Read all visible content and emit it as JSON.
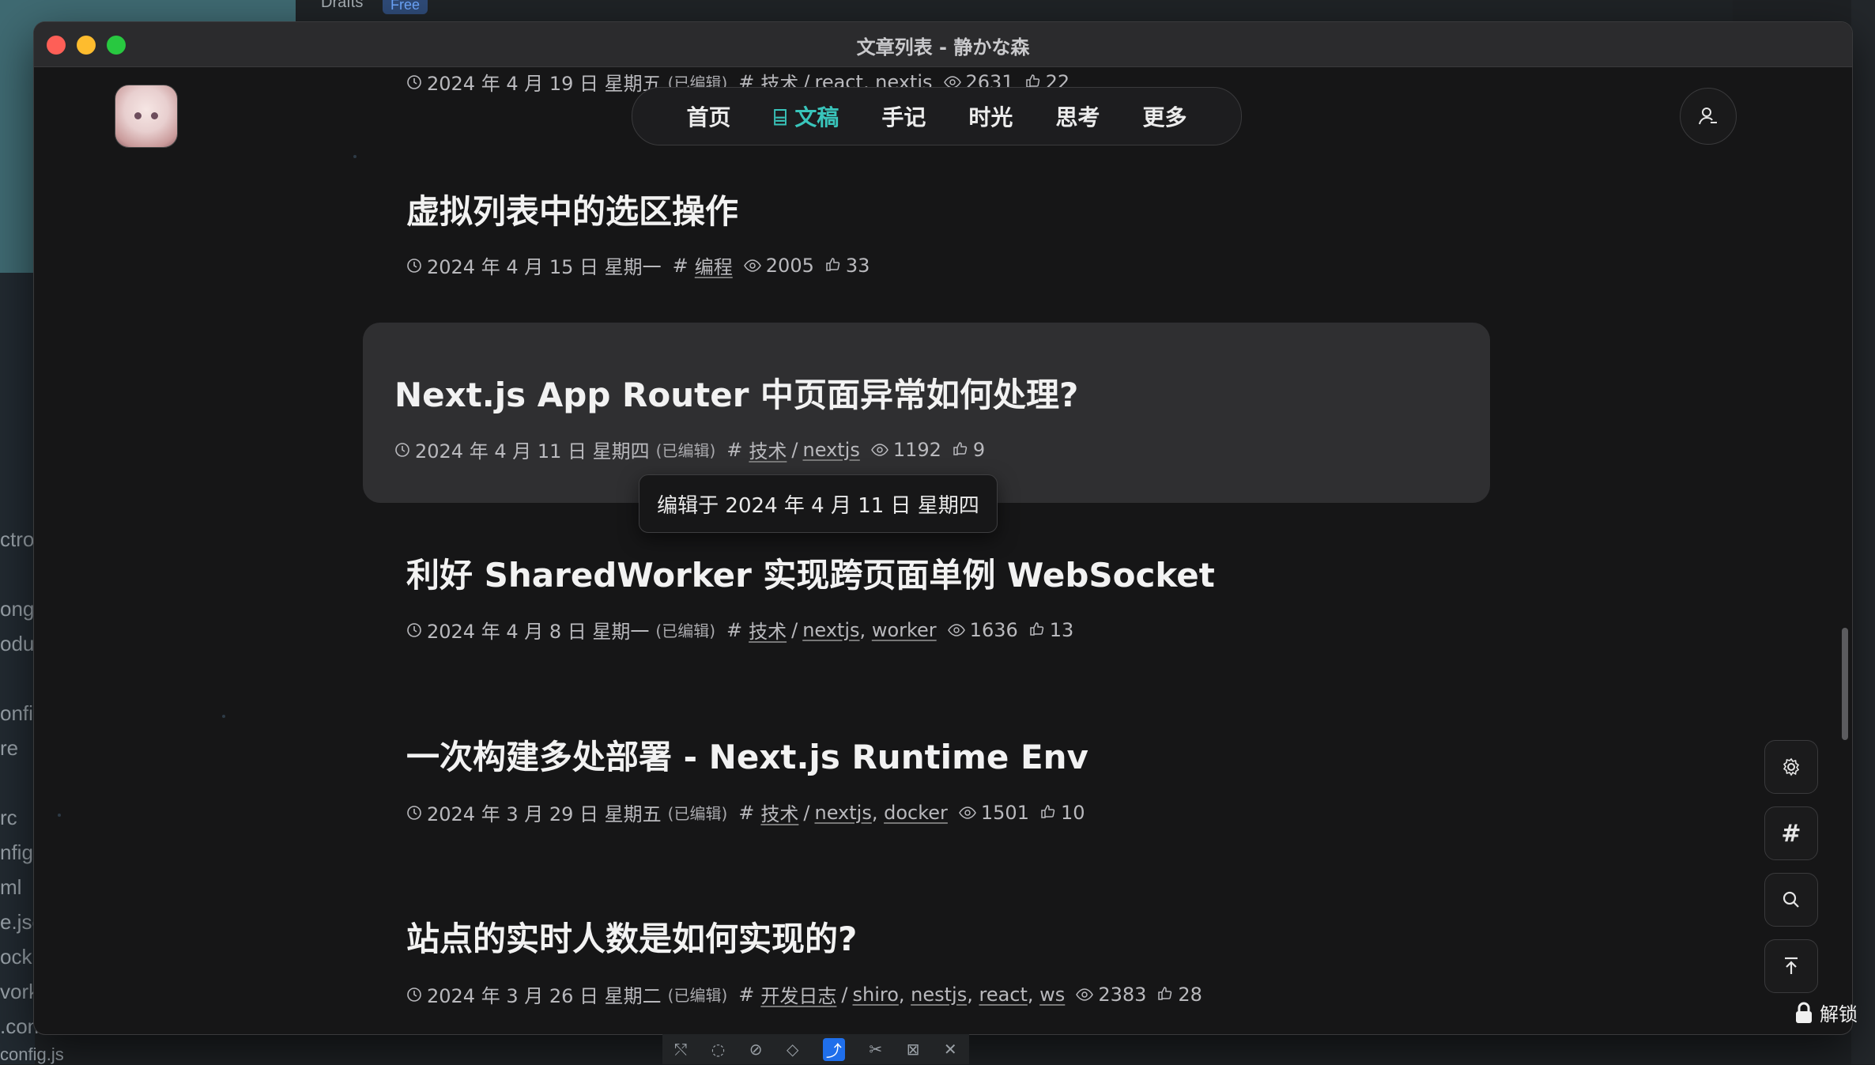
{
  "background": {
    "drafts_label": "Drafts",
    "free_badge": "Free",
    "side_fragments": [
      "ctro",
      "ong",
      "odu",
      "onfi",
      "re",
      "rc",
      "nfig",
      "ml",
      "e.jso",
      "ock.",
      "vork",
      ".con",
      "config.js"
    ]
  },
  "window": {
    "title": "文章列表 - 静かな森"
  },
  "nav": {
    "items": [
      {
        "label": "首页",
        "active": false
      },
      {
        "label": "文稿",
        "active": true
      },
      {
        "label": "手记",
        "active": false
      },
      {
        "label": "时光",
        "active": false
      },
      {
        "label": "思考",
        "active": false
      },
      {
        "label": "更多",
        "active": false
      }
    ]
  },
  "posts": [
    {
      "title": "",
      "date": "2024 年 4 月 19 日 星期五",
      "edited": "(已编辑)",
      "category": "技术",
      "tags": [
        "react",
        "nextjs"
      ],
      "tags_text": "react, nextjs",
      "views": "2631",
      "likes": "22"
    },
    {
      "title": "虚拟列表中的选区操作",
      "date": "2024 年 4 月 15 日 星期一",
      "edited": "",
      "category": "编程",
      "tags": [],
      "views": "2005",
      "likes": "33"
    },
    {
      "title": "Next.js App Router 中页面异常如何处理?",
      "date": "2024 年 4 月 11 日 星期四",
      "edited": "(已编辑)",
      "category": "技术",
      "tags": [
        "nextjs"
      ],
      "views": "1192",
      "likes": "9"
    },
    {
      "title": "利好 SharedWorker 实现跨页面单例 WebSocket",
      "date": "2024 年 4 月 8 日 星期一",
      "edited": "(已编辑)",
      "category": "技术",
      "tags": [
        "nextjs",
        "worker"
      ],
      "views": "1636",
      "likes": "13"
    },
    {
      "title": "一次构建多处部署 - Next.js Runtime Env",
      "date": "2024 年 3 月 29 日 星期五",
      "edited": "(已编辑)",
      "category": "技术",
      "tags": [
        "nextjs",
        "docker"
      ],
      "views": "1501",
      "likes": "10"
    },
    {
      "title": "站点的实时人数是如何实现的?",
      "date": "2024 年 3 月 26 日 星期二",
      "edited": "(已编辑)",
      "category": "开发日志",
      "tags": [
        "shiro",
        "nestjs",
        "react",
        "ws"
      ],
      "views": "2383",
      "likes": "28"
    }
  ],
  "tooltip": "编辑于 2024 年 4 月 11 日 星期四",
  "floating_buttons": [
    "gear-icon",
    "hash-icon",
    "search-icon",
    "back-to-top-icon"
  ],
  "lock_label": "解锁",
  "colors": {
    "accent": "#39c5bb",
    "window_bg": "#161617",
    "card_bg": "#2f2f31"
  }
}
